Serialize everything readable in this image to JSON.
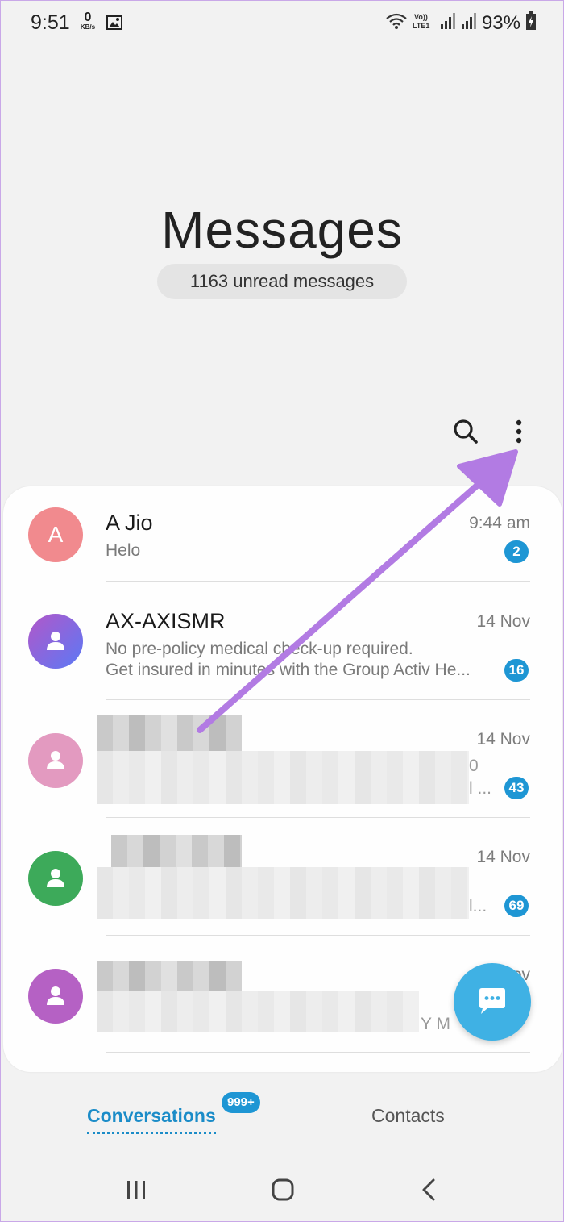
{
  "status_bar": {
    "time": "9:51",
    "net_speed_value": "0",
    "net_speed_unit": "KB/s",
    "battery": "93%"
  },
  "header": {
    "title": "Messages",
    "unread_summary": "1163 unread messages"
  },
  "conversations": [
    {
      "avatar_letter": "A",
      "name": "A Jio",
      "preview": "Helo",
      "time": "9:44 am",
      "unread": "2",
      "avatar_color": "#f18a8e"
    },
    {
      "name": "AX-AXISMR",
      "preview_line1": "No pre-policy medical check-up required.",
      "preview_line2": "Get insured in minutes with the Group Activ He...",
      "time": "14 Nov",
      "unread": "16",
      "avatar_color": "#7b6cf0"
    },
    {
      "time": "14 Nov",
      "unread": "43",
      "partial_text1": "0",
      "partial_text2": "l ...",
      "avatar_color": "#e39ac0"
    },
    {
      "time": "14 Nov",
      "unread": "69",
      "partial_text1": "l...",
      "avatar_color": "#3daa5a"
    },
    {
      "partial_time": "ov",
      "partial_text1": "Y M",
      "avatar_color": "#b561c4"
    }
  ],
  "tabs": {
    "conversations": "Conversations",
    "conversations_badge": "999+",
    "contacts": "Contacts"
  },
  "colors": {
    "accent": "#1e96d4",
    "fab": "#3fb1e4",
    "annotation_arrow": "#b27be3"
  }
}
